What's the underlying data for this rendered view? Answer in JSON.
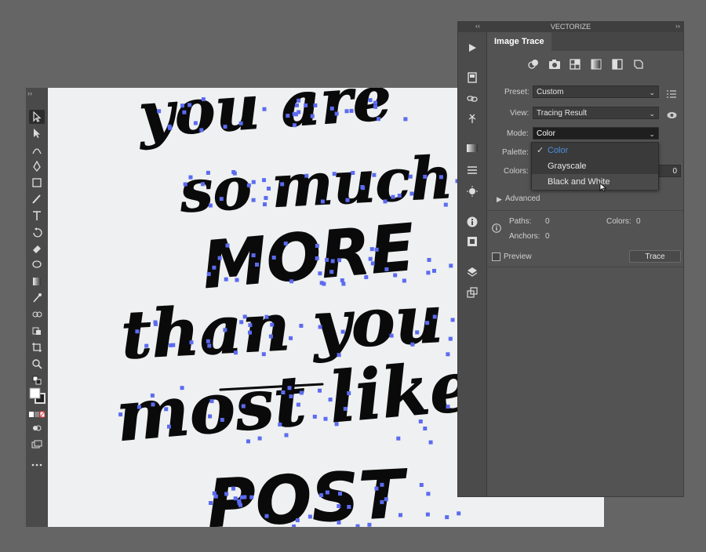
{
  "panel": {
    "title": "VECTORIZE",
    "collapse_left": "‹‹",
    "collapse_right": "››",
    "tab": "Image Trace"
  },
  "toolbar": {
    "grip": "››"
  },
  "image_trace": {
    "preset_label": "Preset:",
    "preset_value": "Custom",
    "view_label": "View:",
    "view_value": "Tracing Result",
    "mode_label": "Mode:",
    "mode_value": "Color",
    "palette_label": "Palette:",
    "colors_label": "Colors:",
    "colors_value": "0",
    "advanced_label": "Advanced",
    "paths_label": "Paths:",
    "paths_value": "0",
    "colors_stat_label": "Colors:",
    "colors_stat_value": "0",
    "anchors_label": "Anchors:",
    "anchors_value": "0",
    "preview_label": "Preview",
    "trace_button": "Trace"
  },
  "mode_menu": {
    "items": [
      {
        "label": "Color",
        "checked": true
      },
      {
        "label": "Grayscale",
        "checked": false
      },
      {
        "label": "Black and White",
        "checked": false
      }
    ],
    "checkmark": "✓"
  },
  "artwork": {
    "lines": [
      "you are",
      "so much",
      "MORE",
      "than you",
      "most like",
      "POST"
    ]
  },
  "colors": {
    "accent": "#4a90e2",
    "anchor": "#5b6bf0",
    "ink": "#0a0a0a"
  }
}
